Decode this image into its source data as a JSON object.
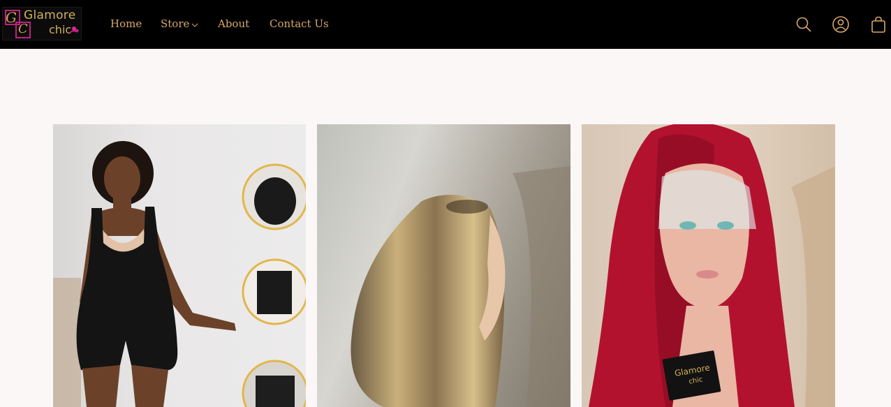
{
  "brand": {
    "logo_line1": "Glamore",
    "logo_line2": "chic",
    "logo_monogram_1": "G",
    "logo_monogram_2": "C"
  },
  "nav": {
    "home": "Home",
    "store": "Store",
    "about": "About",
    "contact": "Contact Us"
  },
  "header_icons": {
    "search": "search-icon",
    "account": "account-icon",
    "cart": "shopping-bag-icon"
  },
  "colors": {
    "header_bg": "#000000",
    "nav_text": "#d8a86a",
    "page_bg": "#fbf7f6",
    "brand_pink": "#c31f83",
    "brand_gold": "#d4b15a"
  },
  "gallery": [
    {
      "name": "shapewear-bodysuit-image"
    },
    {
      "name": "highlighted-bob-wig-image"
    },
    {
      "name": "red-lace-front-wig-image",
      "label_line1": "Glamore",
      "label_line2": "chic"
    }
  ]
}
